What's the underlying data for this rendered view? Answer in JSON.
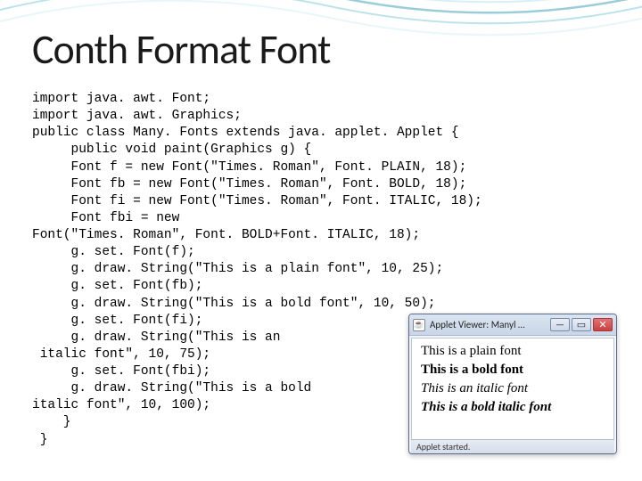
{
  "title": "Conth Format Font",
  "code": "import java. awt. Font;\nimport java. awt. Graphics;\npublic class Many. Fonts extends java. applet. Applet {\n     public void paint(Graphics g) {\n     Font f = new Font(\"Times. Roman\", Font. PLAIN, 18);\n     Font fb = new Font(\"Times. Roman\", Font. BOLD, 18);\n     Font fi = new Font(\"Times. Roman\", Font. ITALIC, 18);\n     Font fbi = new\nFont(\"Times. Roman\", Font. BOLD+Font. ITALIC, 18);\n     g. set. Font(f);\n     g. draw. String(\"This is a plain font\", 10, 25);\n     g. set. Font(fb);\n     g. draw. String(\"This is a bold font\", 10, 50);\n     g. set. Font(fi);\n     g. draw. String(\"This is an\n italic font\", 10, 75);\n     g. set. Font(fbi);\n     g. draw. String(\"This is a bold\nitalic font\", 10, 100);\n    }\n }",
  "applet": {
    "window_title": "Applet Viewer: Manyl …",
    "status": "Applet started.",
    "lines": {
      "plain": "This is a plain font",
      "bold": "This is a bold font",
      "italic": "This is an italic font",
      "bold_italic": "This is a bold italic font"
    },
    "icons": {
      "minimize": "—",
      "maximize": "▭",
      "close": "✕",
      "java": "☕"
    }
  }
}
